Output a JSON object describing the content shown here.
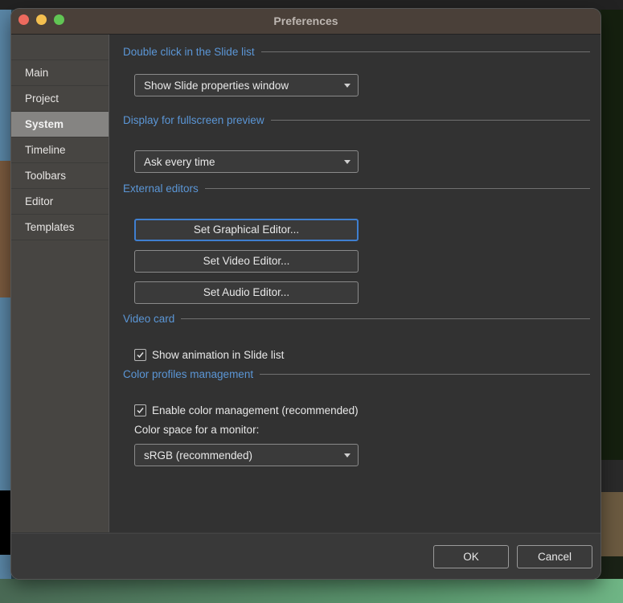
{
  "window": {
    "title": "Preferences"
  },
  "sidebar": {
    "items": [
      {
        "label": "Main"
      },
      {
        "label": "Project"
      },
      {
        "label": "System"
      },
      {
        "label": "Timeline"
      },
      {
        "label": "Toolbars"
      },
      {
        "label": "Editor"
      },
      {
        "label": "Templates"
      }
    ],
    "active": "System"
  },
  "sections": {
    "double_click": {
      "title": "Double click in the Slide list",
      "value": "Show Slide properties window"
    },
    "fullscreen": {
      "title": "Display for fullscreen preview",
      "value": "Ask every time"
    },
    "external_editors": {
      "title": "External editors",
      "graphical": "Set Graphical Editor...",
      "video": "Set Video Editor...",
      "audio": "Set Audio Editor..."
    },
    "video_card": {
      "title": "Video card",
      "show_animation": "Show animation in Slide list",
      "show_animation_checked": true
    },
    "color_profiles": {
      "title": "Color profiles management",
      "enable": "Enable color management (recommended)",
      "enable_checked": true,
      "monitor_label": "Color space for a monitor:",
      "monitor_value": "sRGB (recommended)"
    }
  },
  "footer": {
    "ok": "OK",
    "cancel": "Cancel"
  },
  "colors": {
    "accent": "#5b96d6",
    "focus_ring": "#3f7fd0",
    "titlebar": "#4a4039"
  }
}
